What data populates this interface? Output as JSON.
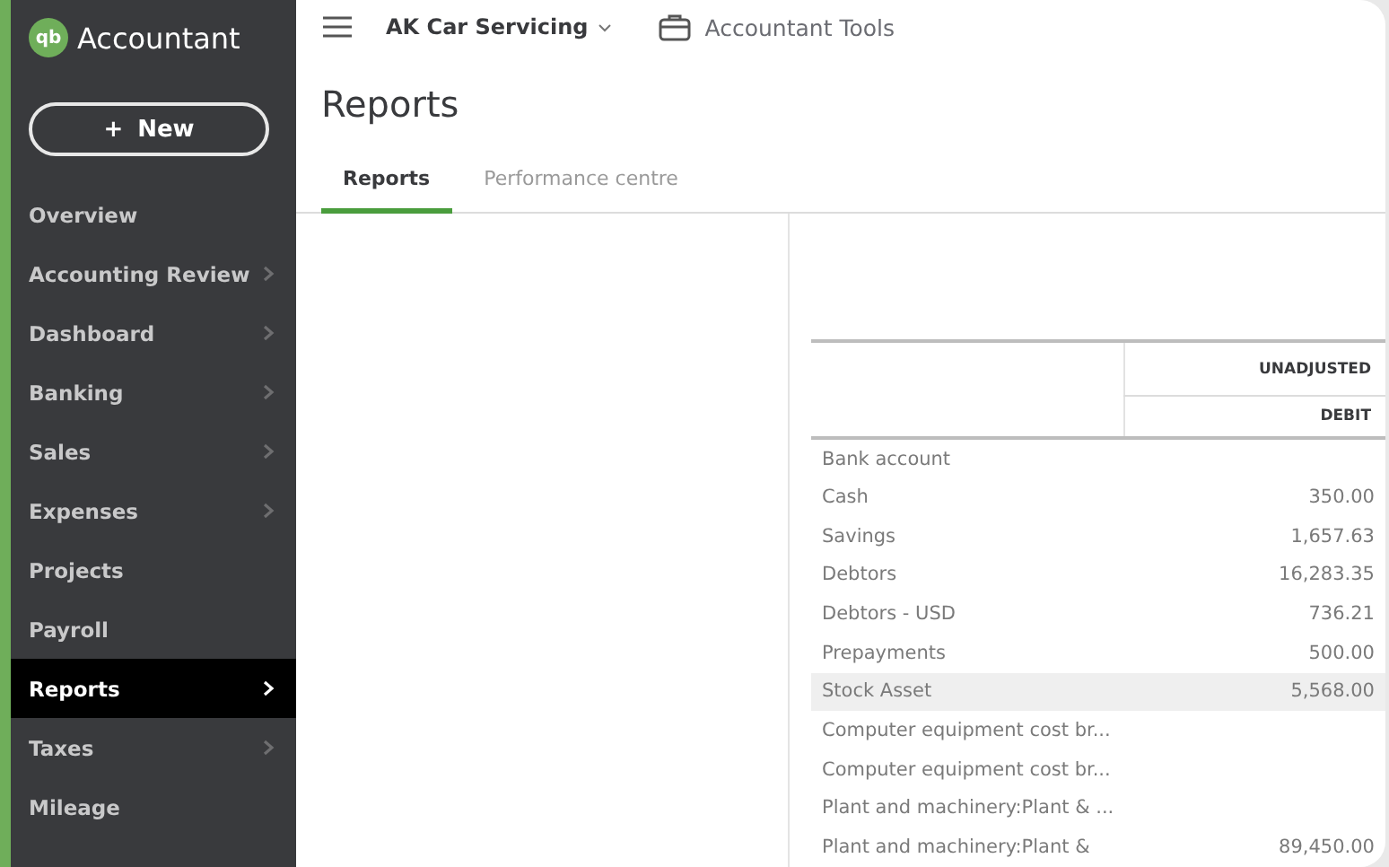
{
  "brand": {
    "logo": "qb",
    "name": "Accountant"
  },
  "new_button": {
    "icon": "+",
    "label": "New"
  },
  "sidebar": {
    "items": [
      {
        "label": "Overview",
        "selected": false,
        "has_chevron": false
      },
      {
        "label": "Accounting Review",
        "selected": false,
        "has_chevron": true
      },
      {
        "label": "Dashboard",
        "selected": false,
        "has_chevron": true
      },
      {
        "label": "Banking",
        "selected": false,
        "has_chevron": true
      },
      {
        "label": "Sales",
        "selected": false,
        "has_chevron": true
      },
      {
        "label": "Expenses",
        "selected": false,
        "has_chevron": true
      },
      {
        "label": "Projects",
        "selected": false,
        "has_chevron": false
      },
      {
        "label": "Payroll",
        "selected": false,
        "has_chevron": false
      },
      {
        "label": "Reports",
        "selected": true,
        "has_chevron": true
      },
      {
        "label": "Taxes",
        "selected": false,
        "has_chevron": true
      },
      {
        "label": "Mileage",
        "selected": false,
        "has_chevron": false
      }
    ]
  },
  "topbar": {
    "company": "AK Car Servicing",
    "tools": "Accountant Tools"
  },
  "page": {
    "title": "Reports"
  },
  "tabs": [
    {
      "label": "Reports",
      "selected": true
    },
    {
      "label": "Performance centre",
      "selected": false
    }
  ],
  "table": {
    "group_header": "UNADJUSTED",
    "columns": [
      "DEBIT"
    ],
    "rows": [
      {
        "account": "Bank account",
        "debit": "",
        "highlighted": false
      },
      {
        "account": "Cash",
        "debit": "350.00",
        "highlighted": false
      },
      {
        "account": "Savings",
        "debit": "1,657.63",
        "highlighted": false
      },
      {
        "account": "Debtors",
        "debit": "16,283.35",
        "highlighted": false
      },
      {
        "account": "Debtors - USD",
        "debit": "736.21",
        "highlighted": false
      },
      {
        "account": "Prepayments",
        "debit": "500.00",
        "highlighted": false
      },
      {
        "account": "Stock Asset",
        "debit": "5,568.00",
        "highlighted": true
      },
      {
        "account": "Computer equipment cost br...",
        "debit": "",
        "highlighted": false
      },
      {
        "account": "Computer equipment cost br...",
        "debit": "",
        "highlighted": false
      },
      {
        "account": "Plant and machinery:Plant & ...",
        "debit": "",
        "highlighted": false
      },
      {
        "account": "Plant and machinery:Plant &",
        "debit": "89,450.00",
        "highlighted": false
      }
    ]
  }
}
